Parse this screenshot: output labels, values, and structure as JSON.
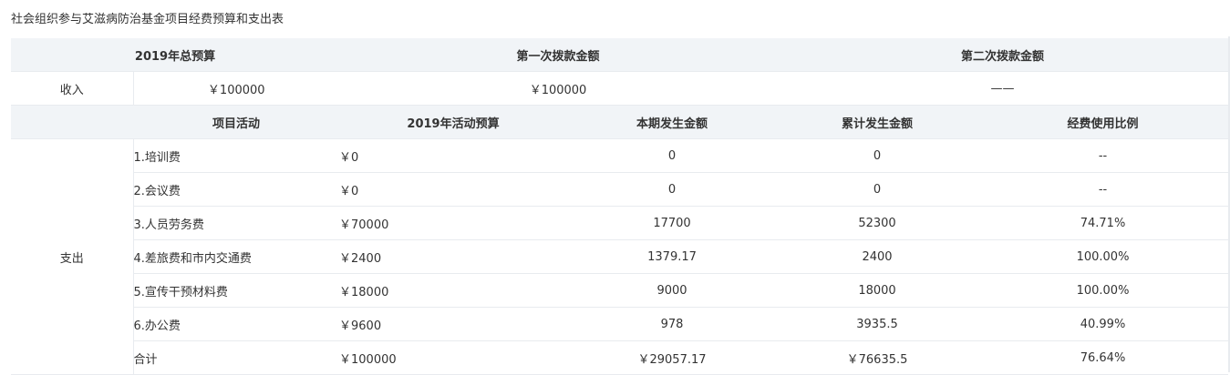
{
  "title": "社会组织参与艾滋病防治基金项目经费预算和支出表",
  "top_headers": [
    "2019年总预算",
    "第一次拨款金额",
    "第二次拨款金额"
  ],
  "income": {
    "label": "收入",
    "total_budget": "￥100000",
    "first_grant": "￥100000",
    "second_grant": "——"
  },
  "expense_headers": [
    "项目活动",
    "2019年活动预算",
    "本期发生金额",
    "累计发生金额",
    "经费使用比例"
  ],
  "expense_label": "支出",
  "rows": [
    {
      "item": "1.培训费",
      "budget": "￥0",
      "current": "0",
      "cumulative": "0",
      "ratio": "--"
    },
    {
      "item": "2.会议费",
      "budget": "￥0",
      "current": "0",
      "cumulative": "0",
      "ratio": "--"
    },
    {
      "item": "3.人员劳务费",
      "budget": "￥70000",
      "current": "17700",
      "cumulative": "52300",
      "ratio": "74.71%"
    },
    {
      "item": "4.差旅费和市内交通费",
      "budget": "￥2400",
      "current": "1379.17",
      "cumulative": "2400",
      "ratio": "100.00%"
    },
    {
      "item": "5.宣传干预材料费",
      "budget": "￥18000",
      "current": "9000",
      "cumulative": "18000",
      "ratio": "100.00%"
    },
    {
      "item": "6.办公费",
      "budget": "￥9600",
      "current": "978",
      "cumulative": "3935.5",
      "ratio": "40.99%"
    },
    {
      "item": "合计",
      "budget": "￥100000",
      "current": "￥29057.17",
      "cumulative": "￥76635.5",
      "ratio": "76.64%"
    }
  ]
}
